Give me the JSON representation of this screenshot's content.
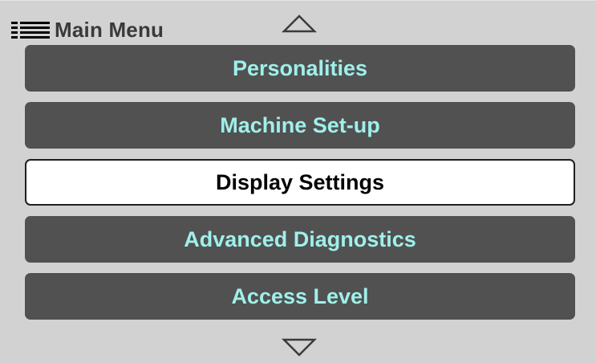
{
  "header": {
    "title": "Main Menu",
    "icon": "list-menu-icon"
  },
  "navigation": {
    "up_icon": "chevron-up-icon",
    "down_icon": "chevron-down-icon"
  },
  "menu": {
    "items": [
      {
        "label": "Personalities",
        "selected": false
      },
      {
        "label": "Machine Set-up",
        "selected": false
      },
      {
        "label": "Display Settings",
        "selected": true
      },
      {
        "label": "Advanced Diagnostics",
        "selected": false
      },
      {
        "label": "Access Level",
        "selected": false
      }
    ]
  },
  "colors": {
    "screen_background": "#d2d2d2",
    "item_background": "#515151",
    "item_text": "#9ff0ea",
    "selected_background": "#ffffff",
    "selected_text": "#000000",
    "title_text": "#3a3a3a"
  }
}
